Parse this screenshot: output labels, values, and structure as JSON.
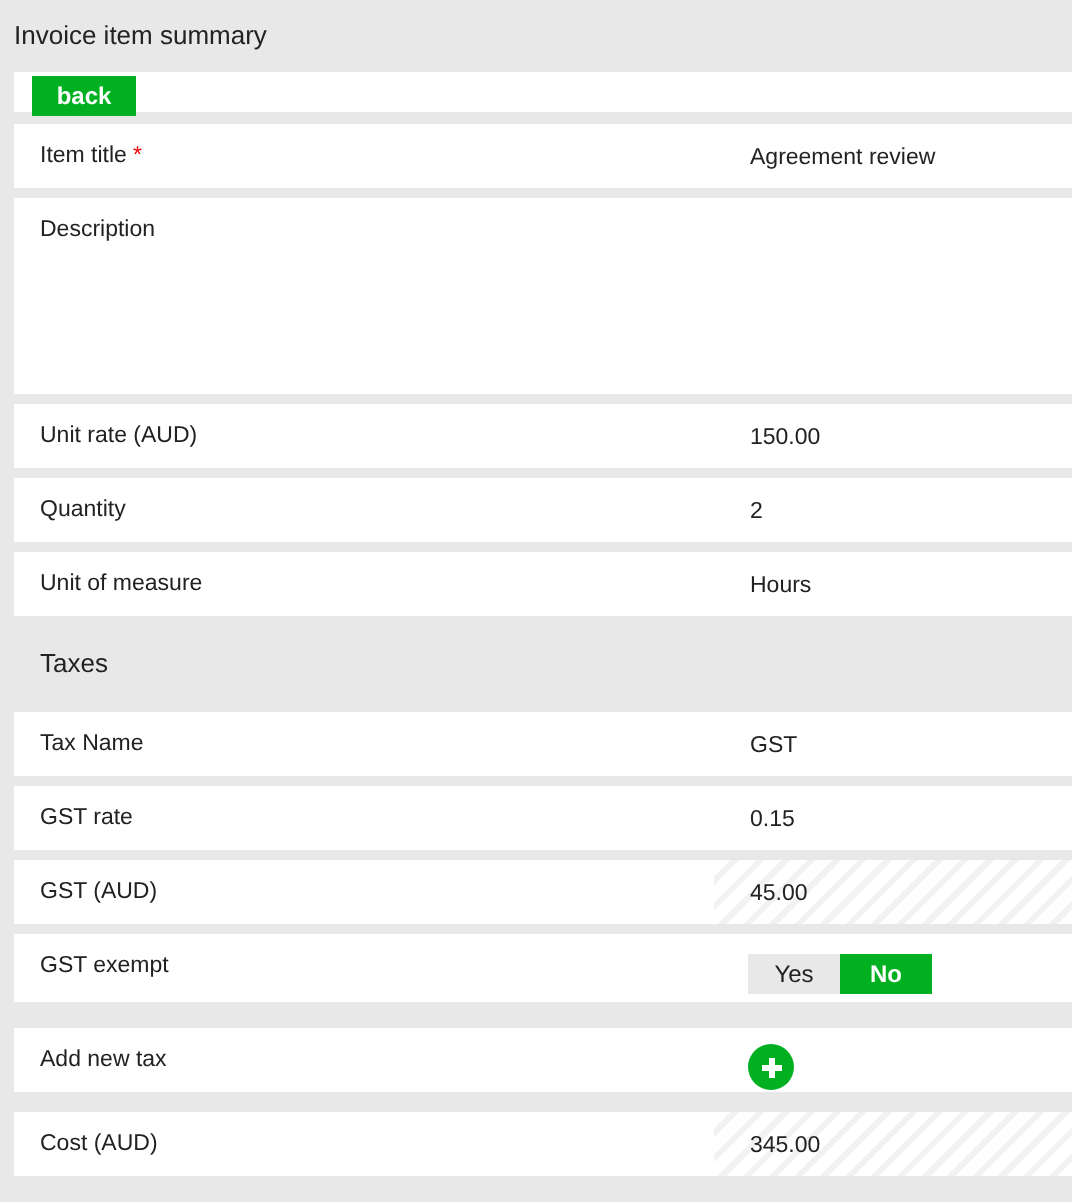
{
  "title": "Invoice item summary",
  "back_button": "back",
  "sections": [
    {
      "rows": [
        {
          "kind": "text",
          "label": "Item title",
          "required_mark": "*",
          "value": "Agreement review"
        },
        {
          "kind": "textarea",
          "label": "Description"
        },
        {
          "kind": "text",
          "label": "Unit rate (AUD)",
          "value": "150.00"
        },
        {
          "kind": "text",
          "label": "Quantity",
          "value": "2"
        },
        {
          "kind": "text",
          "label": "Unit of measure",
          "value": "Hours"
        }
      ]
    },
    {
      "heading": "Taxes",
      "rows": [
        {
          "kind": "text",
          "label": "Tax Name",
          "value": "GST"
        },
        {
          "kind": "text",
          "label": "GST rate",
          "value": "0.15"
        },
        {
          "kind": "readonly",
          "label": "GST (AUD)",
          "value": "45.00"
        },
        {
          "kind": "toggle",
          "label": "GST exempt",
          "options": [
            {
              "label": "Yes",
              "selected": false
            },
            {
              "label": "No",
              "selected": true
            }
          ]
        },
        {
          "kind": "add",
          "label": "Add new tax"
        }
      ]
    },
    {
      "rows": [
        {
          "kind": "readonly",
          "label": "Cost (AUD)",
          "value": "345.00"
        }
      ]
    }
  ]
}
